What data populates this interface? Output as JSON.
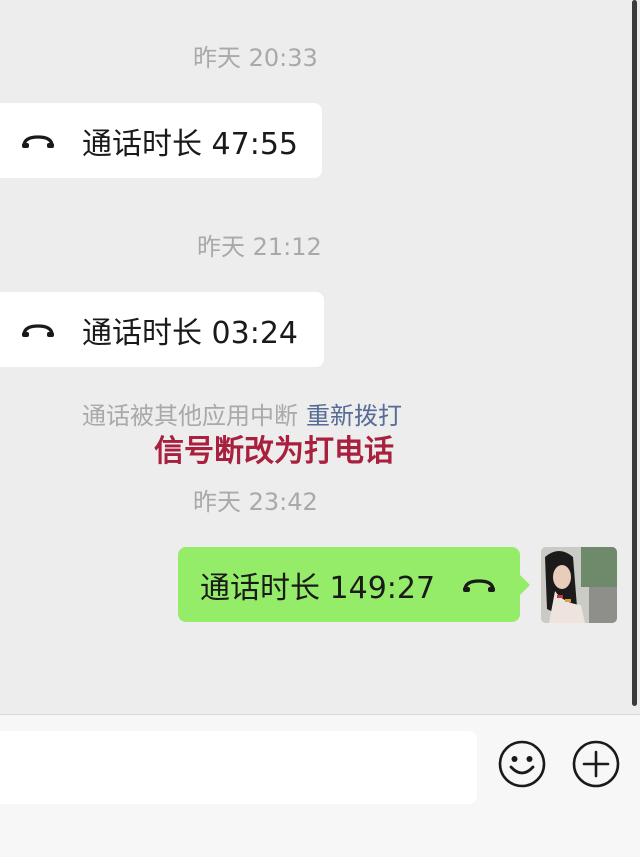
{
  "messages": [
    {
      "timestamp": "昨天 20:33",
      "call": "通话时长 47:55",
      "side": "left"
    },
    {
      "timestamp": "昨天 21:12",
      "call": "通话时长 03:24",
      "side": "left"
    },
    {
      "timestamp": "昨天 23:42",
      "call": "通话时长 149:27",
      "side": "right"
    }
  ],
  "notice": {
    "text": "通话被其他应用中断",
    "redial": "重新拨打"
  },
  "annotation": "信号断改为打电话",
  "input": {
    "value": ""
  },
  "icons": {
    "call": "phone-handset-icon",
    "emoji": "smiley-icon",
    "more": "plus-icon"
  },
  "colors": {
    "background": "#ededed",
    "sent_bubble": "#95ec69",
    "received_bubble": "#ffffff",
    "link": "#576b95",
    "annotation": "#a8203d"
  }
}
